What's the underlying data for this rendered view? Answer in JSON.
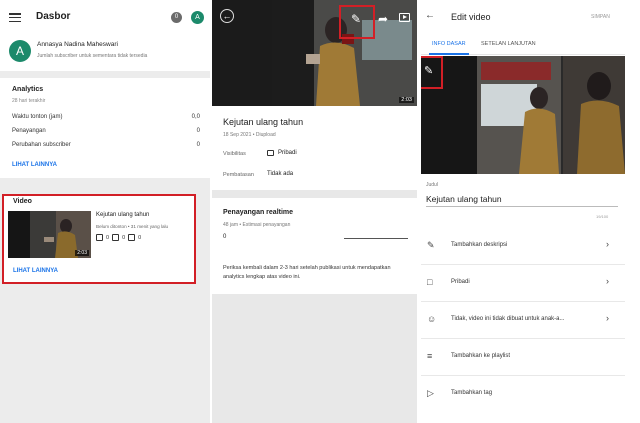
{
  "dashboard": {
    "title": "Dasbor",
    "notification_count": "0",
    "avatar_letter": "A",
    "channel_name": "Annasya Nadina Maheswari",
    "channel_sub": "Jumlah subscriber untuk sementara tidak tersedia",
    "analytics": {
      "title": "Analytics",
      "period": "28 hari terakhir",
      "rows": [
        {
          "label": "Waktu tonton (jam)",
          "value": "0,0"
        },
        {
          "label": "Penayangan",
          "value": "0"
        },
        {
          "label": "Perubahan subscriber",
          "value": "0"
        }
      ],
      "see_more": "LIHAT LAINNYA"
    },
    "video_section": {
      "title": "Video",
      "name": "Kejutan ulang tahun",
      "meta": "Belum ditonton • 31 menit yang lalu",
      "duration": "2:03",
      "likes": "0",
      "dislikes": "0",
      "comments": "0",
      "see_more": "LIHAT LAINNYA"
    }
  },
  "video_detail": {
    "duration": "2:03",
    "title": "Kejutan ulang tahun",
    "meta": "18 Sep 2021 • Diupload",
    "visibility_label": "Visibilitas",
    "visibility_value": "Pribadi",
    "restriction_label": "Pembatasan",
    "restriction_value": "Tidak ada",
    "realtime_title": "Penayangan realtime",
    "realtime_sub": "48 jam • Estimasi penayangan",
    "realtime_value": "0",
    "note": "Periksa kembali dalam 2-3 hari setelah publikasi untuk mendapatkan analytics lengkap atas video ini."
  },
  "edit_video": {
    "title": "Edit video",
    "save_label": "SIMPAN",
    "tabs": [
      "INFO DASAR",
      "SETELAN LANJUTAN"
    ],
    "field_label": "Judul",
    "field_value": "Kejutan ulang tahun",
    "char_count": "19/100",
    "rows": [
      {
        "icon": "pencil-icon",
        "label": "Tambahkan deskripsi"
      },
      {
        "icon": "lock-icon",
        "label": "Pribadi"
      },
      {
        "icon": "child-icon",
        "label": "Tidak, video ini tidak dibuat untuk anak-a..."
      },
      {
        "icon": "playlist-add-icon",
        "label": "Tambahkan ke playlist"
      },
      {
        "icon": "tag-icon",
        "label": "Tambahkan tag"
      }
    ]
  },
  "colors": {
    "highlight": "#d21f26",
    "link_blue": "#1a73e8",
    "avatar_green": "#1c8a6b"
  }
}
